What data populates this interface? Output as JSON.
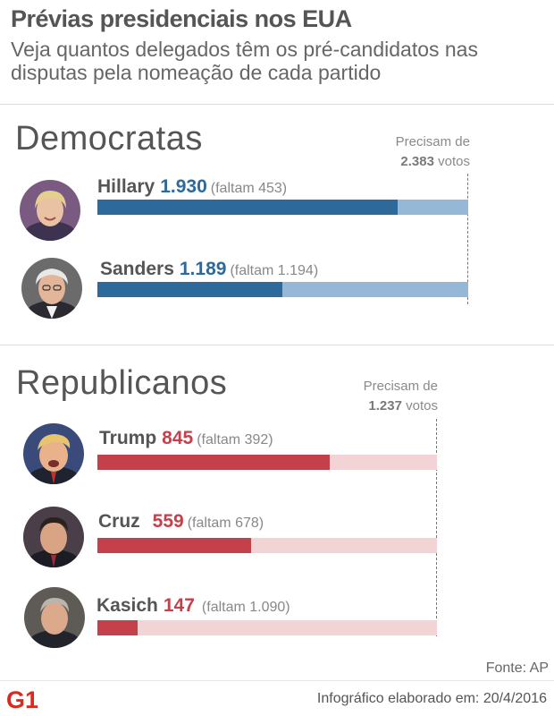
{
  "header": {
    "title": "Prévias presidenciais nos EUA",
    "subtitle": "Veja quantos delegados têm os pré-candidatos nas disputas pela nomeação de cada partido"
  },
  "colors": {
    "dem_fill": "#2d6a9b",
    "dem_rest": "#95b8d6",
    "rep_fill": "#c4404b",
    "rep_rest": "#f2d4d7",
    "logo": "#e1261c"
  },
  "sections": [
    {
      "name": "Democratas",
      "needs_prefix": "Precisam de",
      "needs_value": "2.383",
      "needs_suffix": "votos"
    },
    {
      "name": "Republicanos",
      "needs_prefix": "Precisam de",
      "needs_value": "1.237",
      "needs_suffix": "votos"
    }
  ],
  "candidates": [
    {
      "name": "Hillary",
      "value_label": "1.930",
      "remaining_label": "(faltam 453)"
    },
    {
      "name": "Sanders",
      "value_label": "1.189",
      "remaining_label": "(faltam 1.194)"
    },
    {
      "name": "Trump",
      "value_label": "845",
      "remaining_label": "(faltam 392)"
    },
    {
      "name": "Cruz",
      "value_label": "559",
      "remaining_label": "(faltam 678)"
    },
    {
      "name": "Kasich",
      "value_label": "147",
      "remaining_label": "(faltam 1.090)"
    }
  ],
  "chart_data": [
    {
      "type": "bar",
      "orientation": "horizontal",
      "title": "Democratas",
      "categories": [
        "Hillary",
        "Sanders"
      ],
      "values": [
        1930,
        1189
      ],
      "remaining": [
        453,
        1194
      ],
      "target": 2383,
      "xlim": [
        0,
        2383
      ]
    },
    {
      "type": "bar",
      "orientation": "horizontal",
      "title": "Republicanos",
      "categories": [
        "Trump",
        "Cruz",
        "Kasich"
      ],
      "values": [
        845,
        559,
        147
      ],
      "remaining": [
        392,
        678,
        1090
      ],
      "target": 1237,
      "xlim": [
        0,
        1237
      ]
    }
  ],
  "footer": {
    "source": "Fonte: AP",
    "logo_text": "G1",
    "credit": "Infográfico elaborado em: 20/4/2016"
  }
}
